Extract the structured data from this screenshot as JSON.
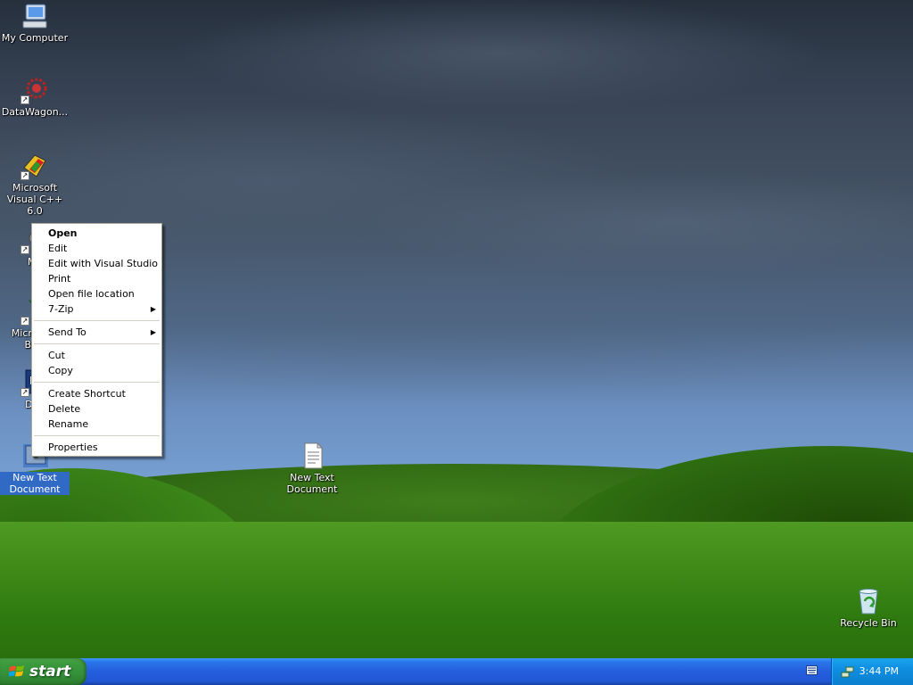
{
  "desktop": {
    "icons": [
      {
        "label": "My Computer",
        "icon": "my-computer-icon"
      },
      {
        "label": "DataWagon...",
        "icon": "datawagon-icon"
      },
      {
        "label": "Microsoft Visual C++ 6.0",
        "icon": "visual-cpp-icon"
      },
      {
        "label": "My",
        "icon": "shortcut-icon"
      },
      {
        "label": "Microso... Basi",
        "icon": "visual-basic-icon"
      },
      {
        "label": "Dev",
        "icon": "dev-icon"
      },
      {
        "label": "New Text Document",
        "icon": "text-document-icon",
        "selected": true
      },
      {
        "label": "New Text Document",
        "icon": "notepad-document-icon"
      },
      {
        "label": "Recycle Bin",
        "icon": "recycle-bin-icon"
      }
    ]
  },
  "context_menu": {
    "items": [
      {
        "label": "Open",
        "bold": true
      },
      {
        "label": "Edit"
      },
      {
        "label": "Edit with Visual Studio"
      },
      {
        "label": "Print"
      },
      {
        "label": "Open file location"
      },
      {
        "label": "7-Zip",
        "submenu": true
      },
      {
        "label": "Send To",
        "submenu": true
      },
      {
        "label": "Cut"
      },
      {
        "label": "Copy"
      },
      {
        "label": "Create Shortcut"
      },
      {
        "label": "Delete"
      },
      {
        "label": "Rename"
      },
      {
        "label": "Properties"
      }
    ],
    "submenu_arrow": "▶"
  },
  "taskbar": {
    "start_label": "start",
    "clock": "3:44 PM"
  },
  "colors": {
    "selection": "#316ac5",
    "taskbar_blue": "#245edc",
    "start_green": "#35903b",
    "tray_blue": "#0f8ee0"
  }
}
